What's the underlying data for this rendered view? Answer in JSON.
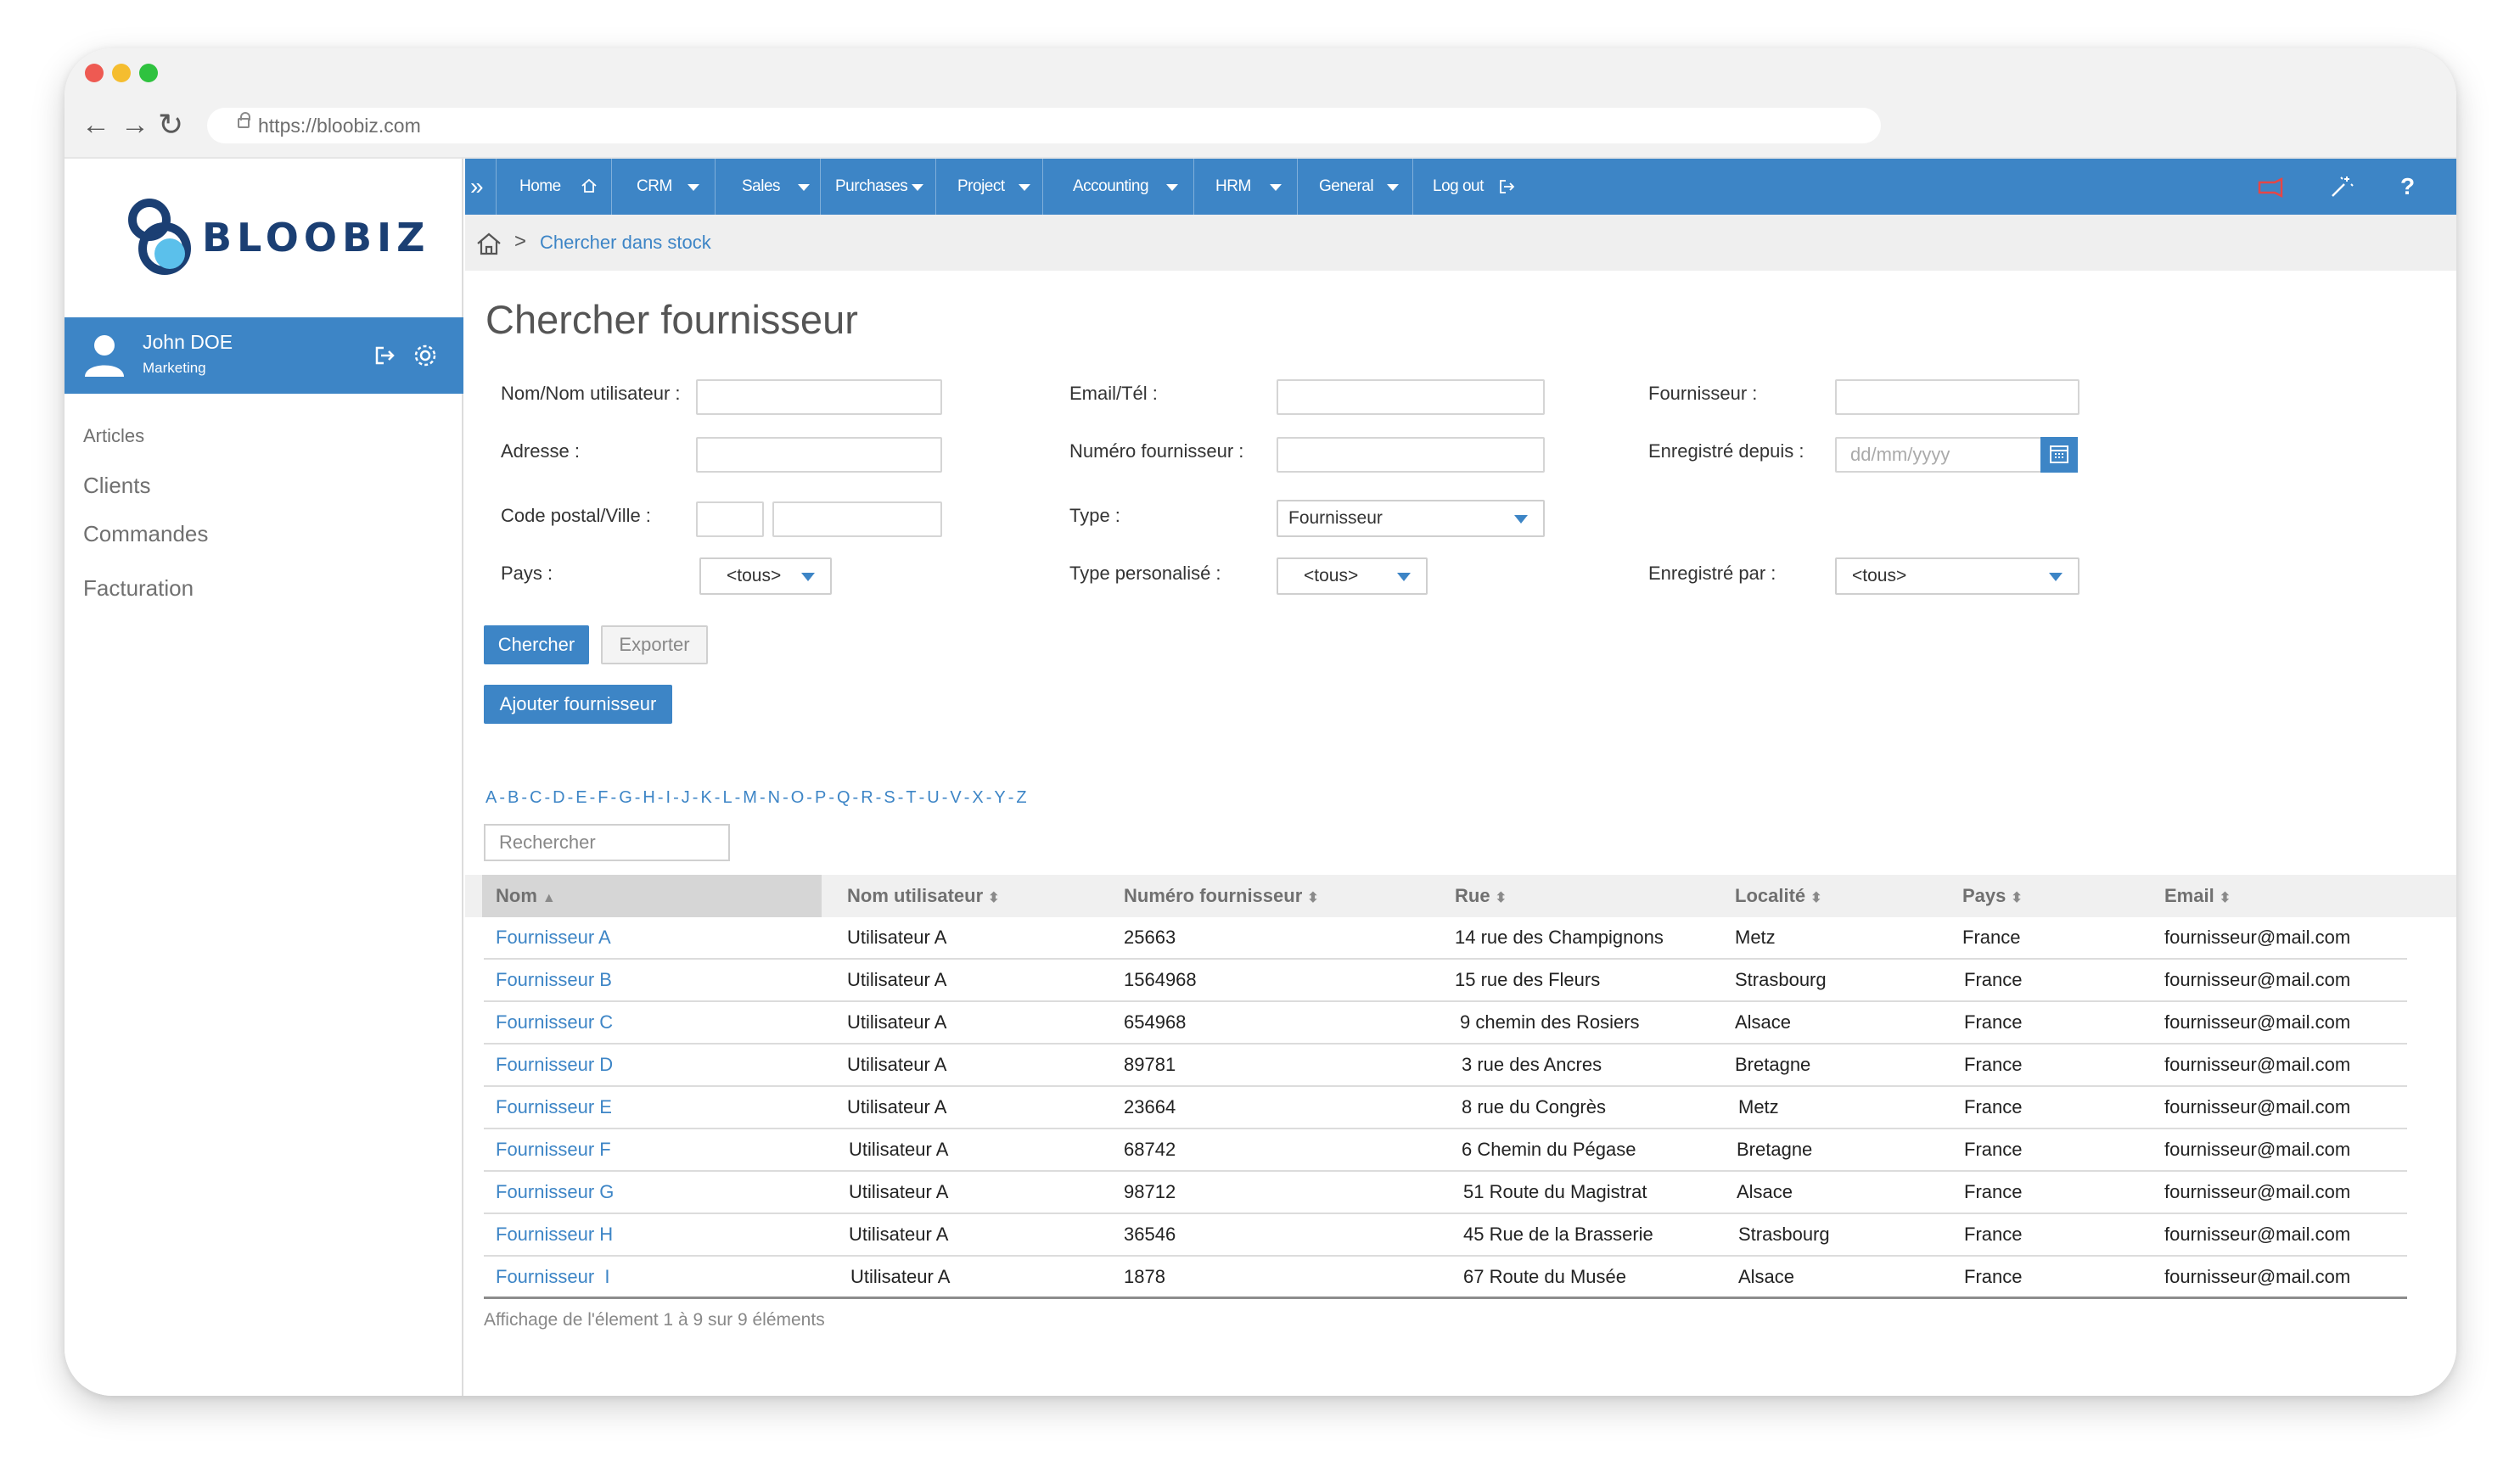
{
  "browser": {
    "url": "https://bloobiz.com",
    "back_glyph": "←",
    "forward_glyph": "→",
    "reload_glyph": "↻"
  },
  "brand": {
    "name": "BLOOBIZ",
    "color": "#1b3f73",
    "accent": "#3d85c6"
  },
  "user": {
    "name": "John DOE",
    "role": "Marketing"
  },
  "sidebar": {
    "items": [
      {
        "label": "Articles"
      },
      {
        "label": "Clients"
      },
      {
        "label": "Commandes"
      },
      {
        "label": "Facturation"
      }
    ]
  },
  "topnav": {
    "toggle": "»",
    "items": [
      {
        "label": "Home"
      },
      {
        "label": "CRM"
      },
      {
        "label": "Sales"
      },
      {
        "label": "Purchases"
      },
      {
        "label": "Project"
      },
      {
        "label": "Accounting"
      },
      {
        "label": "HRM"
      },
      {
        "label": "General"
      },
      {
        "label": "Log out"
      }
    ],
    "help": "?"
  },
  "breadcrumb": {
    "separator": ">",
    "current": "Chercher dans stock"
  },
  "page": {
    "title": "Chercher fournisseur"
  },
  "form": {
    "nom_label": "Nom/Nom utilisateur :",
    "email_label": "Email/Tél :",
    "fournisseur_label": "Fournisseur :",
    "adresse_label": "Adresse :",
    "numero_label": "Numéro fournisseur :",
    "enregistre_depuis_label": "Enregistré depuis :",
    "enregistre_depuis_placeholder": "dd/mm/yyyy",
    "code_postal_label": "Code postal/Ville :",
    "type_label": "Type :",
    "type_value": "Fournisseur",
    "pays_label": "Pays :",
    "pays_value": "<tous>",
    "type_perso_label": "Type personalisé :",
    "type_perso_value": "<tous>",
    "enregistre_par_label": "Enregistré par :",
    "enregistre_par_value": "<tous>"
  },
  "buttons": {
    "search": "Chercher",
    "export": "Exporter",
    "add": "Ajouter fournisseur"
  },
  "alphabet": [
    "A",
    "B",
    "C",
    "D",
    "E",
    "F",
    "G",
    "H",
    "I",
    "J",
    "K",
    "L",
    "M",
    "N",
    "O",
    "P",
    "Q",
    "R",
    "S",
    "T",
    "U",
    "V",
    "X",
    "Y",
    "Z"
  ],
  "table_search": {
    "placeholder": "Rechercher"
  },
  "table": {
    "headers": [
      "Nom",
      "Nom utilisateur",
      "Numéro fournisseur",
      "Rue",
      "Localité",
      "Pays",
      "Email"
    ],
    "sort_active": "▲",
    "sort_both": "⬍",
    "rows": [
      [
        "Fournisseur A",
        "Utilisateur A",
        "25663",
        "14 rue des Champignons",
        "Metz",
        "France",
        "fournisseur@mail.com"
      ],
      [
        "Fournisseur B",
        "Utilisateur A",
        "1564968",
        "15 rue des Fleurs",
        "Strasbourg",
        "France",
        "fournisseur@mail.com"
      ],
      [
        "Fournisseur C",
        "Utilisateur A",
        "654968",
        "9 chemin des Rosiers",
        "Alsace",
        "France",
        "fournisseur@mail.com"
      ],
      [
        "Fournisseur D",
        "Utilisateur A",
        "89781",
        "3 rue des Ancres",
        "Bretagne",
        "France",
        "fournisseur@mail.com"
      ],
      [
        "Fournisseur E",
        "Utilisateur A",
        "23664",
        "8 rue du Congrès",
        "Metz",
        "France",
        "fournisseur@mail.com"
      ],
      [
        "Fournisseur F",
        "Utilisateur A",
        "68742",
        "6 Chemin du Pégase",
        "Bretagne",
        "France",
        "fournisseur@mail.com"
      ],
      [
        "Fournisseur G",
        "Utilisateur A",
        "98712",
        "51 Route du Magistrat",
        "Alsace",
        "France",
        "fournisseur@mail.com"
      ],
      [
        "Fournisseur H",
        "Utilisateur A",
        "36546",
        "45 Rue de la Brasserie",
        "Strasbourg",
        "France",
        "fournisseur@mail.com"
      ],
      [
        "Fournisseur  I",
        "Utilisateur A",
        "1878",
        "67 Route du Musée",
        "Alsace",
        "France",
        "fournisseur@mail.com"
      ]
    ],
    "info": "Affichage de l'élement 1 à 9 sur 9 éléments"
  }
}
